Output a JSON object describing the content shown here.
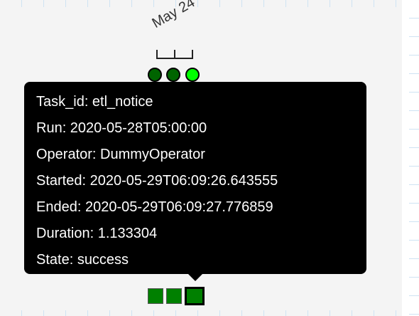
{
  "date_label": "May 24",
  "tooltip": {
    "lines": [
      "Task_id: etl_notice",
      "Run: 2020-05-28T05:00:00",
      "Operator: DummyOperator",
      "Started: 2020-05-29T06:09:26.643555",
      "Ended: 2020-05-29T06:09:27.776859",
      "Duration: 1.133304",
      "State: success"
    ]
  },
  "colors": {
    "dag_run_success_dark": "#006400",
    "dag_run_success_light": "#00ff00",
    "task_success": "#008000"
  }
}
